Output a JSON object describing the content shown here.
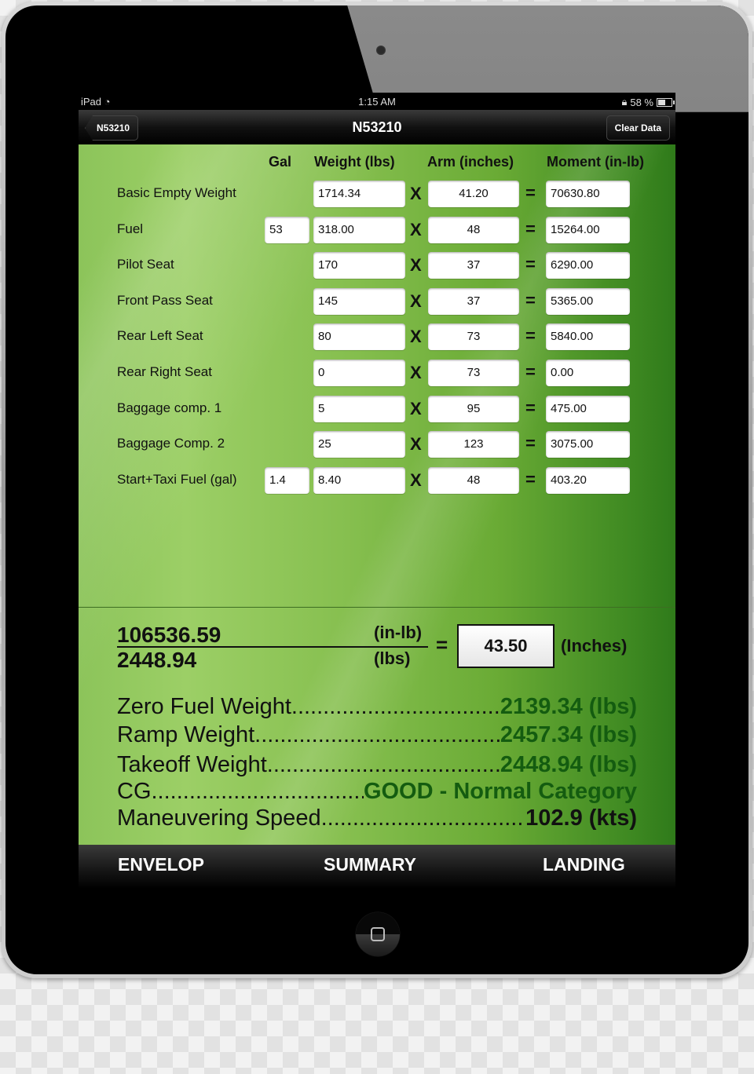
{
  "status_bar": {
    "device": "iPad",
    "time": "1:15 AM",
    "battery_percent": "58 %",
    "battery_level": 0.58
  },
  "nav": {
    "title": "N53210",
    "back_label": "N53210",
    "clear_label": "Clear Data"
  },
  "columns": {
    "gal": "Gal",
    "weight": "Weight (lbs)",
    "arm": "Arm (inches)",
    "moment": "Moment (in-lb)"
  },
  "operators": {
    "times": "X",
    "equals": "="
  },
  "rows": [
    {
      "label": "Basic Empty Weight",
      "gal": null,
      "weight": "1714.34",
      "arm": "41.20",
      "moment": "70630.80"
    },
    {
      "label": "Fuel",
      "gal": "53",
      "weight": "318.00",
      "arm": "48",
      "moment": "15264.00"
    },
    {
      "label": "Pilot Seat",
      "gal": null,
      "weight": "170",
      "arm": "37",
      "moment": "6290.00"
    },
    {
      "label": "Front Pass Seat",
      "gal": null,
      "weight": "145",
      "arm": "37",
      "moment": "5365.00"
    },
    {
      "label": "Rear Left Seat",
      "gal": null,
      "weight": "80",
      "arm": "73",
      "moment": "5840.00"
    },
    {
      "label": "Rear Right Seat",
      "gal": null,
      "weight": "0",
      "arm": "73",
      "moment": "0.00"
    },
    {
      "label": "Baggage comp. 1",
      "gal": null,
      "weight": "5",
      "arm": "95",
      "moment": "475.00"
    },
    {
      "label": "Baggage Comp. 2",
      "gal": null,
      "weight": "25",
      "arm": "123",
      "moment": "3075.00"
    },
    {
      "label": "Start+Taxi Fuel (gal)",
      "gal": "1.4",
      "weight": "8.40",
      "arm": "48",
      "moment": "403.20"
    }
  ],
  "cg_calc": {
    "total_moment": "106536.59",
    "total_weight": "2448.94",
    "moment_unit": "(in-lb)",
    "weight_unit": "(lbs)",
    "equals": "=",
    "cg_value": "43.50",
    "cg_unit": "(Inches)"
  },
  "summary": [
    {
      "label": "Zero Fuel Weight ",
      "value": "2139.34 (lbs)",
      "green": true
    },
    {
      "label": "Ramp Weight ",
      "value": "2457.34 (lbs)",
      "green": true
    },
    {
      "label": "Takeoff Weight ",
      "value": " 2448.94 (lbs)",
      "green": true
    },
    {
      "label": "CG ",
      "value": " GOOD - Normal Category",
      "green": true
    },
    {
      "label": "Maneuvering Speed ",
      "value": " 102.9 (kts)",
      "green": false
    }
  ],
  "tabs": [
    {
      "label": "ENVELOP"
    },
    {
      "label": "SUMMARY"
    },
    {
      "label": "LANDING"
    }
  ],
  "colors": {
    "value_green": "#145c10",
    "background_green": "#6aab35"
  }
}
